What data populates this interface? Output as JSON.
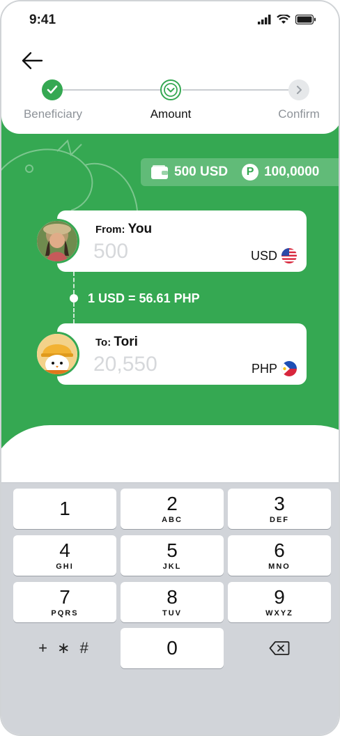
{
  "status_bar": {
    "time": "9:41"
  },
  "stepper": {
    "steps": [
      {
        "label": "Beneficiary",
        "state": "done"
      },
      {
        "label": "Amount",
        "state": "active"
      },
      {
        "label": "Confirm",
        "state": "pending"
      }
    ]
  },
  "balance": {
    "usd": "500 USD",
    "points": "100,0000"
  },
  "from_card": {
    "prefix": "From:",
    "name": "You",
    "amount_placeholder": "500",
    "currency": "USD"
  },
  "rate": {
    "text": "1 USD = 56.61 PHP"
  },
  "to_card": {
    "prefix": "To:",
    "name": "Tori",
    "amount_placeholder": "20,550",
    "currency": "PHP"
  },
  "keypad": {
    "keys": [
      {
        "digit": "1",
        "letters": ""
      },
      {
        "digit": "2",
        "letters": "ABC"
      },
      {
        "digit": "3",
        "letters": "DEF"
      },
      {
        "digit": "4",
        "letters": "GHI"
      },
      {
        "digit": "5",
        "letters": "JKL"
      },
      {
        "digit": "6",
        "letters": "MNO"
      },
      {
        "digit": "7",
        "letters": "PQRS"
      },
      {
        "digit": "8",
        "letters": "TUV"
      },
      {
        "digit": "9",
        "letters": "WXYZ"
      },
      {
        "digit": "0",
        "letters": ""
      }
    ],
    "symbols": "+ ∗ #"
  },
  "colors": {
    "brand_green": "#35a852",
    "pending_grey": "#c9cdd1",
    "keypad_bg": "#d1d4d9"
  },
  "icons": {
    "back": "arrow-left-icon",
    "step_done": "check-icon",
    "step_active": "chevron-down-icon",
    "step_pending": "chevron-right-icon",
    "wallet": "wallet-icon",
    "points": "p-coin-icon",
    "usd_flag": "us-flag-icon",
    "php_flag": "ph-flag-icon",
    "backspace": "backspace-icon"
  }
}
